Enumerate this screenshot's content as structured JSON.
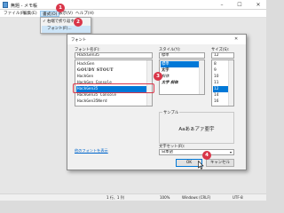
{
  "window": {
    "title": "無題 - メモ帳",
    "minimize": "–",
    "maximize": "☐",
    "close": "✕"
  },
  "menubar": {
    "items": [
      "ファイル(F)",
      "編集(E)",
      "書式(O)",
      "表示(V)",
      "ヘルプ(H)"
    ]
  },
  "format_menu": {
    "items": [
      "右端で折り返す(W)",
      "フォント(F)..."
    ],
    "checkmark": "✓"
  },
  "markers": [
    "1",
    "2",
    "3",
    "4"
  ],
  "font_dialog": {
    "title": "フォント",
    "close": "✕",
    "font_name_label": "フォント名(F):",
    "font_name_value": "HackGen35",
    "fonts": [
      "HackGen",
      "GOUDY STOUT",
      "HackGen",
      "HackGen Console",
      "HackGen35",
      "HackGen35 Console",
      "HackGen35Nerd"
    ],
    "style_label": "スタイル(Y):",
    "style_value": "標準",
    "styles": [
      "標準",
      "太字",
      "斜体",
      "太字 斜体"
    ],
    "size_label": "サイズ(S):",
    "size_value": "12",
    "sizes": [
      "8",
      "9",
      "10",
      "11",
      "12",
      "14",
      "16"
    ],
    "sample_label": "サンプル",
    "sample_text": "Aaあぁアァ亜宇",
    "charset_label": "文字セット(R):",
    "charset_value": "日本語",
    "show_more_fonts": "他のフォントを表示",
    "ok": "OK",
    "cancel": "キャンセル"
  },
  "statusbar": {
    "position": "1 行、1 列",
    "zoom": "100%",
    "line_ending": "Windows (CRLF)",
    "encoding": "UTF-8"
  }
}
